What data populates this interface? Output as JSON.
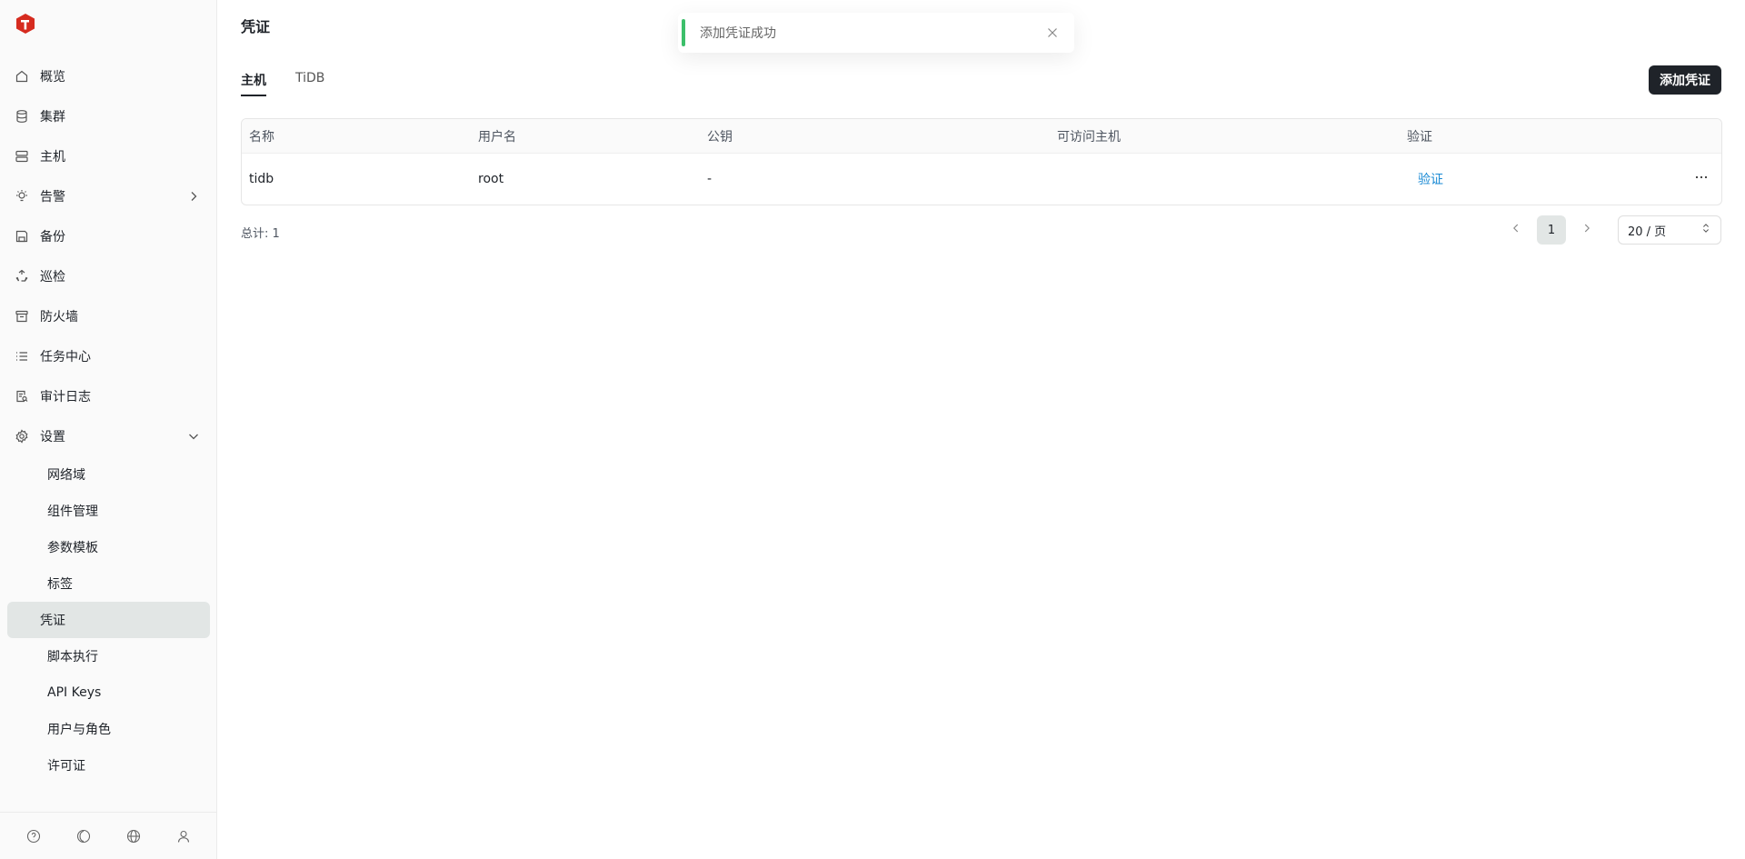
{
  "colors": {
    "brand": "#d62b1f",
    "primary_button": "#1f2329",
    "link": "#1a8ad4",
    "success": "#3cbf6a",
    "active_bg": "#e2e6e5"
  },
  "sidebar": {
    "items": [
      {
        "label": "概览",
        "icon": "home-icon"
      },
      {
        "label": "集群",
        "icon": "database-icon"
      },
      {
        "label": "主机",
        "icon": "server-icon"
      },
      {
        "label": "告警",
        "icon": "bulb-icon"
      },
      {
        "label": "备份",
        "icon": "save-icon"
      },
      {
        "label": "巡检",
        "icon": "recycle-icon"
      },
      {
        "label": "防火墙",
        "icon": "archive-icon"
      },
      {
        "label": "任务中心",
        "icon": "list-icon"
      },
      {
        "label": "审计日志",
        "icon": "audit-icon"
      },
      {
        "label": "设置",
        "icon": "gear-icon"
      }
    ],
    "settings_sub": [
      {
        "label": "网络域"
      },
      {
        "label": "组件管理"
      },
      {
        "label": "参数模板"
      },
      {
        "label": "标签"
      },
      {
        "label": "凭证"
      },
      {
        "label": "脚本执行"
      },
      {
        "label": "API Keys"
      },
      {
        "label": "用户与角色"
      },
      {
        "label": "许可证"
      }
    ]
  },
  "header": {
    "title": "凭证"
  },
  "tabs": [
    {
      "label": "主机"
    },
    {
      "label": "TiDB"
    }
  ],
  "toolbar": {
    "add_label": "添加凭证"
  },
  "table": {
    "columns": [
      "名称",
      "用户名",
      "公钥",
      "可访问主机",
      "验证"
    ],
    "rows": [
      {
        "name": "tidb",
        "username": "root",
        "pubkey": "-",
        "hosts": "",
        "verify": "验证"
      }
    ]
  },
  "footer": {
    "total": "总计: 1"
  },
  "pagination": {
    "current": "1",
    "page_size": "20 / 页"
  },
  "toast": {
    "message": "添加凭证成功"
  }
}
